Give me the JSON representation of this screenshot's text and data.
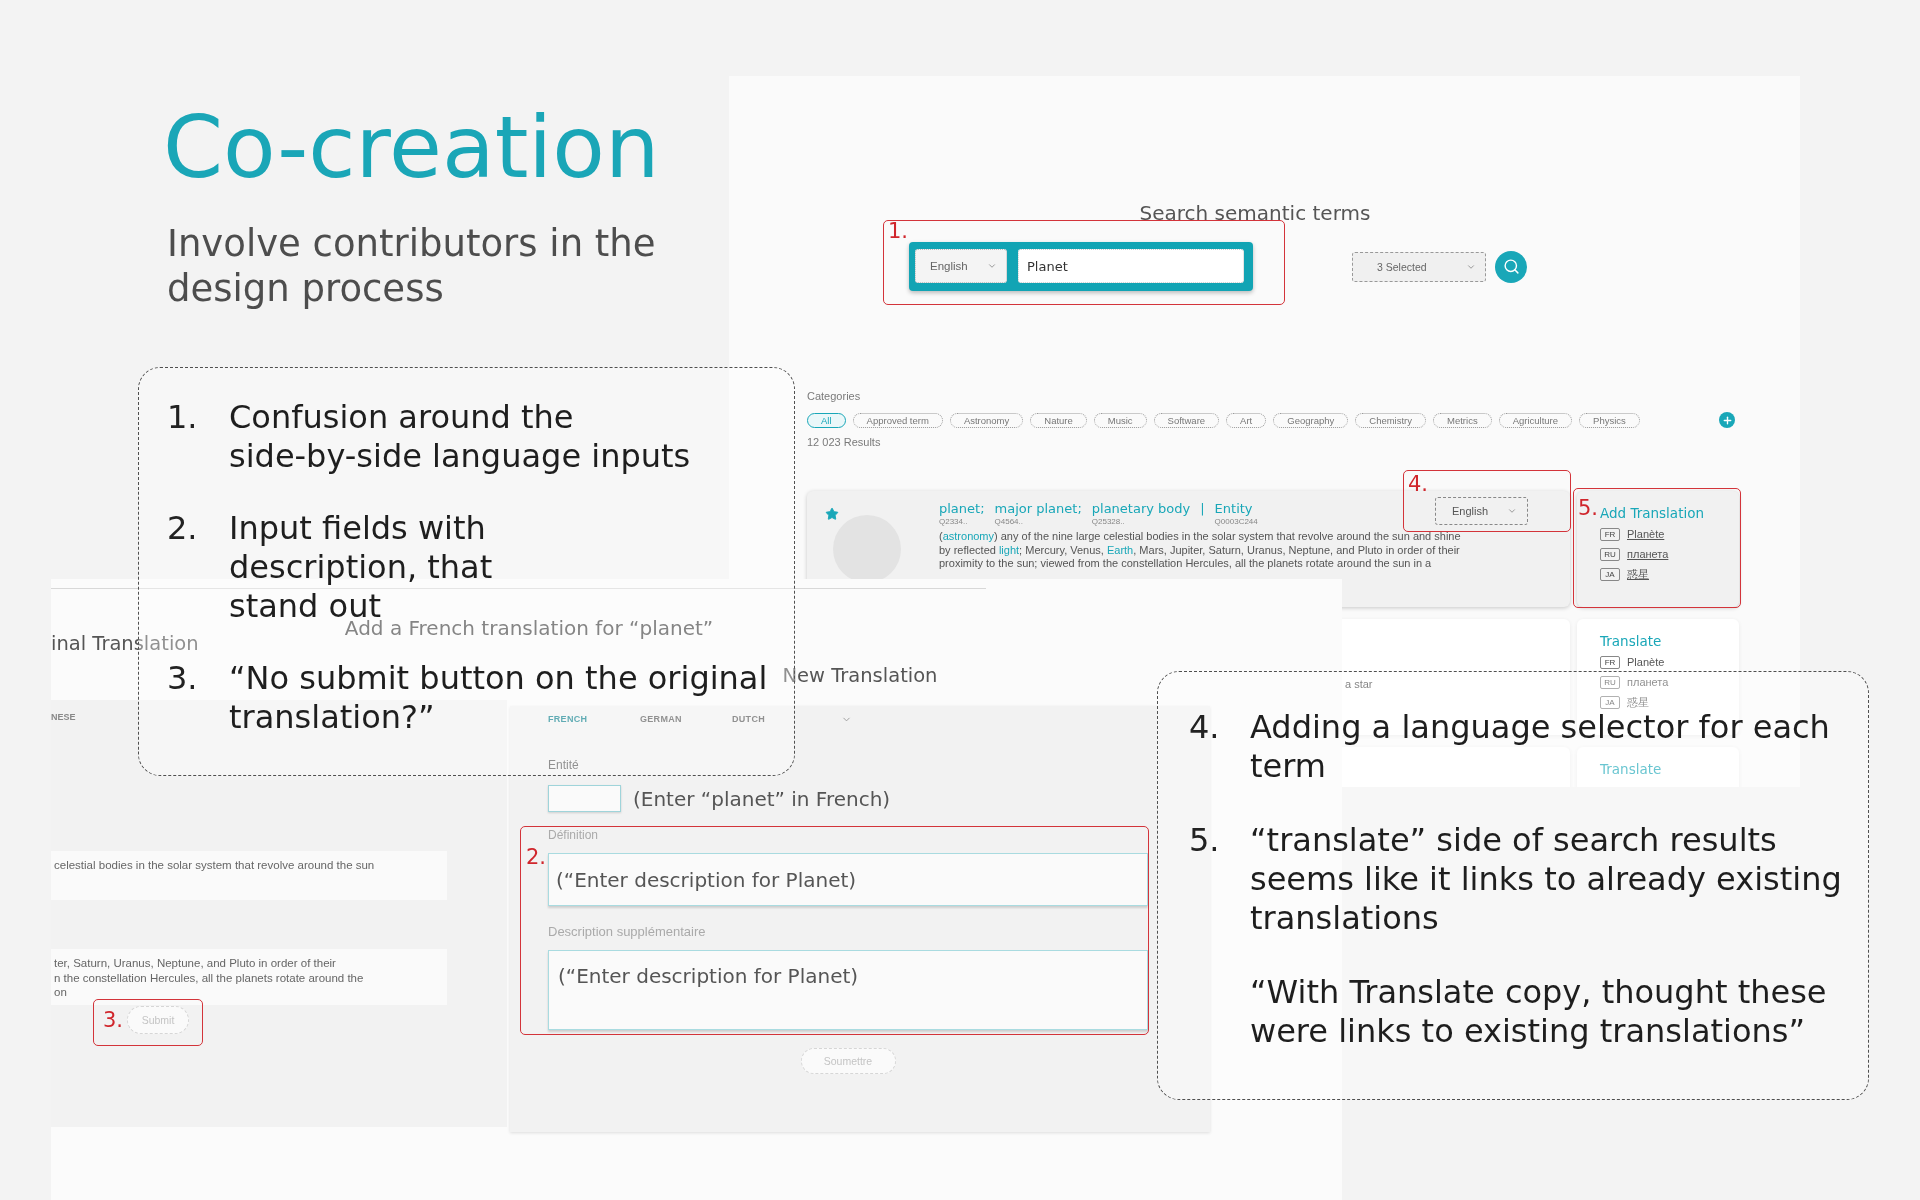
{
  "title": "Co-creation",
  "subtitle": "Involve contributors in the design process",
  "search_screen": {
    "heading": "Search semantic terms",
    "search_bar": {
      "language": "English",
      "query": "Planet",
      "annotation": "1."
    },
    "filter": "3 Selected",
    "categories_label": "Categories",
    "categories": [
      {
        "label": "All",
        "selected": true
      },
      {
        "label": "Approved term",
        "selected": false
      },
      {
        "label": "Astronomy",
        "selected": false
      },
      {
        "label": "Nature",
        "selected": false
      },
      {
        "label": "Music",
        "selected": false
      },
      {
        "label": "Software",
        "selected": false
      },
      {
        "label": "Art",
        "selected": false
      },
      {
        "label": "Geography",
        "selected": false
      },
      {
        "label": "Chemistry",
        "selected": false
      },
      {
        "label": "Metrics",
        "selected": false
      },
      {
        "label": "Agriculture",
        "selected": false
      },
      {
        "label": "Physics",
        "selected": false
      }
    ],
    "results_count": "12 023 Results",
    "results": [
      {
        "kind": "full",
        "highlighted": true,
        "starred": true,
        "terms": [
          {
            "text": "planet;",
            "id": "Q2334.."
          },
          {
            "text": "major planet;",
            "id": "Q4564.."
          },
          {
            "text": "planetary body",
            "id": "Q25328.."
          }
        ],
        "separator": "|",
        "entity": {
          "text": "Entity",
          "id": "Q0003C244"
        },
        "language": "English",
        "language_annotation": "4.",
        "definition": [
          {
            "text": "(",
            "link": false
          },
          {
            "text": "astronomy",
            "link": true
          },
          {
            "text": ") any of the nine large celestial bodies in the solar system that revolve around the sun and shine\nby reflected ",
            "link": false
          },
          {
            "text": "light",
            "link": true
          },
          {
            "text": "; Mercury, Venus, ",
            "link": false
          },
          {
            "text": "Earth",
            "link": true
          },
          {
            "text": ", Mars, Jupiter, Saturn, Uranus, Neptune, and Pluto in order of their\nproximity to the sun; viewed from the constellation Hercules, all the planets rotate around the sun in a",
            "link": false
          }
        ],
        "translate": {
          "title": "Add Translation",
          "annotation": "5.",
          "items": [
            {
              "code": "FR",
              "text": "Planète"
            },
            {
              "code": "RU",
              "text": "планета"
            },
            {
              "code": "JA",
              "text": "惑星"
            }
          ]
        }
      },
      {
        "kind": "snippet",
        "highlighted": false,
        "snippet": "a star",
        "translate": {
          "title": "Translate",
          "items": [
            {
              "code": "FR",
              "text": "Planète"
            },
            {
              "code": "RU",
              "text": "планета"
            },
            {
              "code": "JA",
              "text": "惑星"
            }
          ]
        }
      },
      {
        "kind": "snippet",
        "translate": {
          "title": "Translate"
        }
      }
    ]
  },
  "translation_screen": {
    "heading": "Add a French translation for “planet”",
    "original": {
      "title": "inal Translation",
      "tab": "NESE",
      "fields": [
        "celestial bodies in the solar system that revolve around the sun",
        "ter, Saturn, Uranus, Neptune, and Pluto in order of their\nn the constellation Hercules, all the planets rotate around the\non"
      ],
      "submit": "Submit",
      "submit_annotation": "3."
    },
    "new": {
      "title": "New Translation",
      "tabs": [
        {
          "label": "FRENCH",
          "selected": true
        },
        {
          "label": "GERMAN",
          "selected": false
        },
        {
          "label": "DUTCH",
          "selected": false
        }
      ],
      "entity": {
        "label": "Entité",
        "note": "(Enter “planet” in French)"
      },
      "fields": [
        {
          "kind": "line",
          "label": "Définition",
          "value": "(“Enter description for Planet)"
        },
        {
          "kind": "area",
          "label": "Description supplémentaire",
          "value": "(“Enter description for Planet)"
        }
      ],
      "fields_annotation": "2.",
      "submit": "Soumettre"
    }
  },
  "notes_left": {
    "items": [
      {
        "kind": "item",
        "number": "1.",
        "text": "Confusion around the\nside-by-side language inputs"
      },
      {
        "kind": "item",
        "number": "2.",
        "text": "Input fields with\ndescription, that\nstand out"
      },
      {
        "kind": "item",
        "number": "3.",
        "text": "“No submit button on the original\ntranslation?”"
      }
    ]
  },
  "notes_right": {
    "items": [
      {
        "kind": "item",
        "number": "4.",
        "text": "Adding a language selector for each\nterm"
      },
      {
        "kind": "item",
        "number": "5.",
        "text": "“translate” side of search results\nseems like it links to already existing\ntranslations"
      },
      {
        "kind": "quote",
        "text": "“With Translate copy, thought these\nwere links to existing translations”"
      }
    ]
  }
}
